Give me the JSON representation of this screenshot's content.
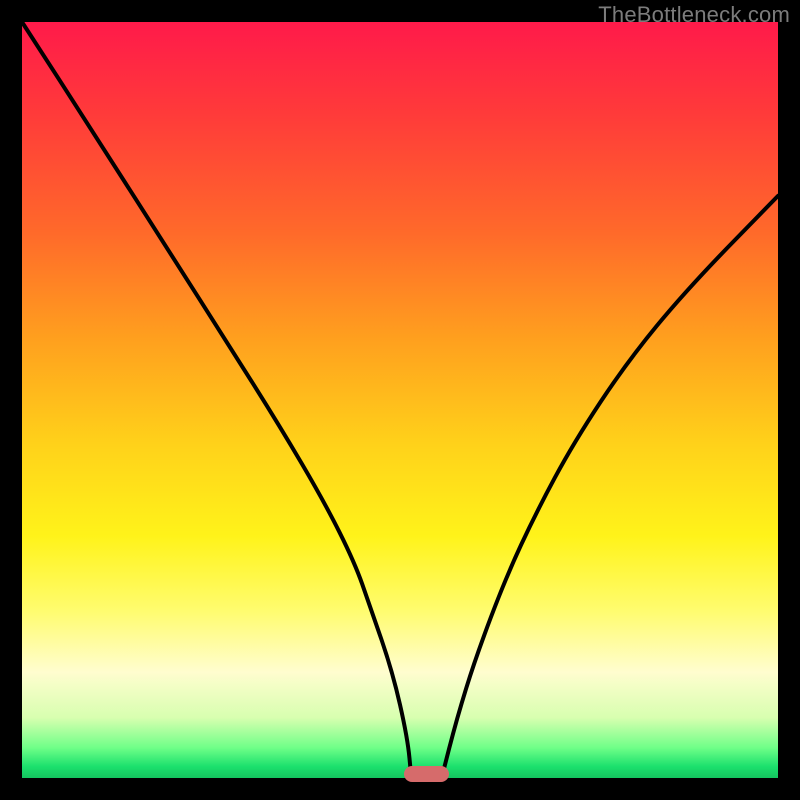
{
  "watermark": "TheBottleneck.com",
  "colors": {
    "background": "#000000",
    "curve": "#000000",
    "marker": "#d66b6b"
  },
  "chart_data": {
    "type": "line",
    "title": "",
    "xlabel": "",
    "ylabel": "",
    "xlim": [
      0,
      100
    ],
    "ylim": [
      0,
      100
    ],
    "grid": false,
    "series": [
      {
        "name": "left-curve",
        "x": [
          0,
          10,
          20,
          27,
          34,
          40,
          44,
          46,
          49,
          51,
          51.5
        ],
        "y": [
          100,
          84.5,
          68.8,
          57.8,
          46.7,
          36.5,
          28.5,
          22.8,
          14.1,
          5.3,
          0
        ]
      },
      {
        "name": "right-curve",
        "x": [
          55.5,
          57.5,
          60,
          64,
          68,
          73,
          80,
          88,
          100
        ],
        "y": [
          0,
          7.8,
          15.9,
          26.5,
          35.1,
          44.4,
          55.0,
          64.7,
          77.0
        ]
      }
    ],
    "marker": {
      "x": 53.5,
      "y": 0,
      "width_pct": 6.0,
      "height_pct": 2.0
    }
  }
}
